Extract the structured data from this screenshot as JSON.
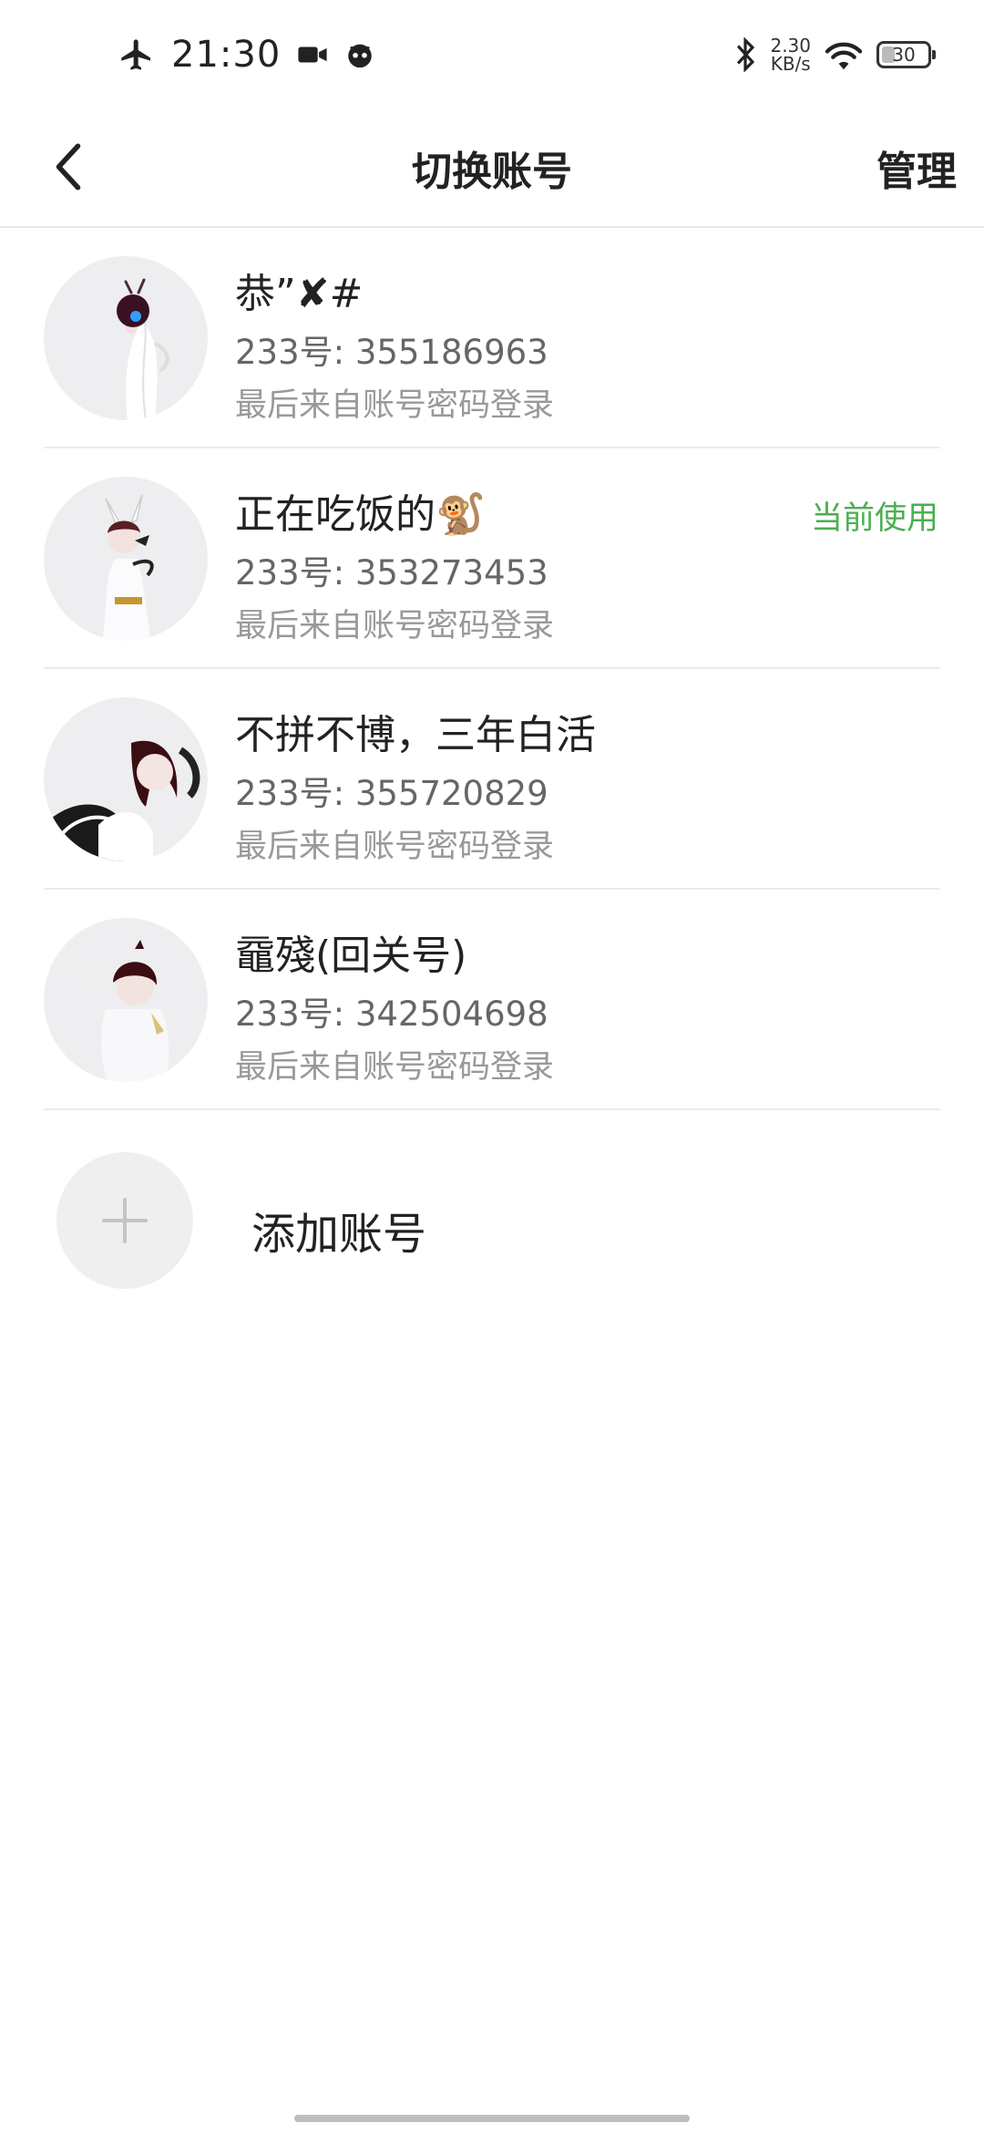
{
  "status_bar": {
    "time": "21:30",
    "net_speed_value": "2.30",
    "net_speed_unit": "KB/s",
    "battery_level": "30"
  },
  "header": {
    "title": "切换账号",
    "manage": "管理"
  },
  "accounts": [
    {
      "name": "恭”✘#",
      "uid": "233号: 355186963",
      "login": "最后来自账号密码登录",
      "current": false
    },
    {
      "name": "正在吃饭的🐒",
      "uid": "233号: 353273453",
      "login": "最后来自账号密码登录",
      "current": true,
      "current_label": "当前使用"
    },
    {
      "name": "不拼不博，三年白活",
      "uid": "233号: 355720829",
      "login": "最后来自账号密码登录",
      "current": false
    },
    {
      "name": "黿殘(回关号)",
      "uid": "233号: 342504698",
      "login": "最后来自账号密码登录",
      "current": false
    }
  ],
  "add_account": {
    "label": "添加账号"
  },
  "colors": {
    "accent_green": "#4caf50",
    "divider": "#ececec",
    "avatar_bg": "#eeeef0"
  }
}
